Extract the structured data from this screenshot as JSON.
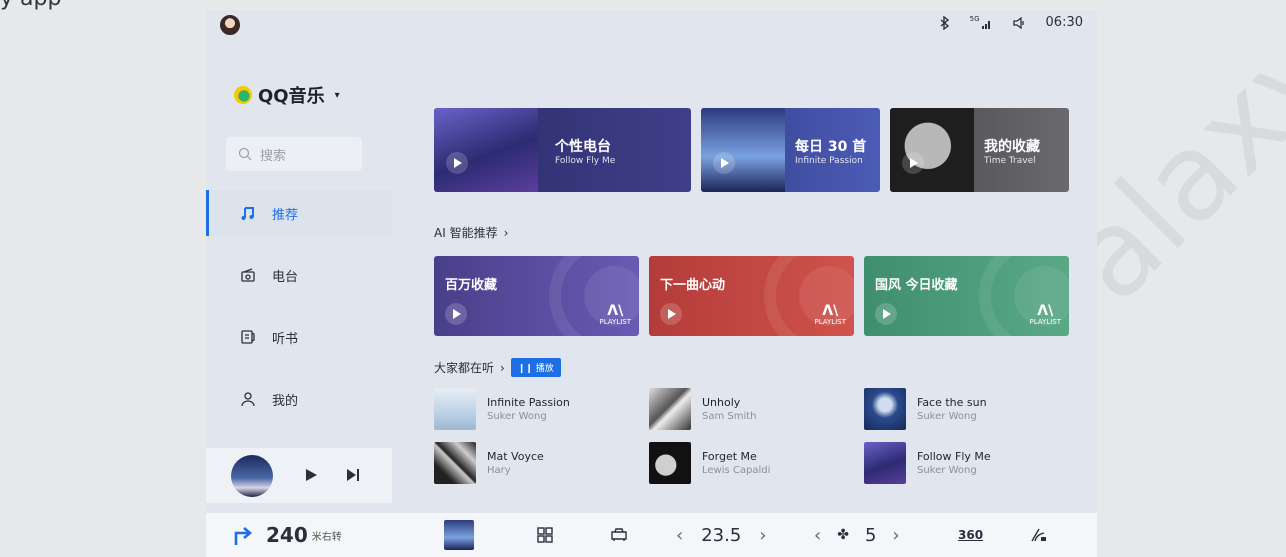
{
  "top_clip_text": "y app",
  "watermark": "alaxy",
  "status": {
    "time": "06:30",
    "signal_label": "5G"
  },
  "brand": {
    "name": "QQ音乐"
  },
  "search": {
    "placeholder": "搜索"
  },
  "nav": [
    {
      "label": "推荐",
      "icon": "music-note-icon",
      "active": true
    },
    {
      "label": "电台",
      "icon": "radio-icon",
      "active": false
    },
    {
      "label": "听书",
      "icon": "book-icon",
      "active": false
    },
    {
      "label": "我的",
      "icon": "user-icon",
      "active": false
    }
  ],
  "featured": [
    {
      "title": "个性电台",
      "subtitle": "Follow Fly Me"
    },
    {
      "title": "每日 30 首",
      "subtitle": "Infinite Passion"
    },
    {
      "title": "我的收藏",
      "subtitle": "Time Travel"
    }
  ],
  "ai_section": {
    "title": "AI 智能推荐"
  },
  "ai_cards": [
    {
      "title": "百万收藏",
      "badge": "PLAYLIST",
      "color": "#5a4f9e"
    },
    {
      "title": "下一曲心动",
      "badge": "PLAYLIST",
      "color": "#c2453f"
    },
    {
      "title": "国风 今日收藏",
      "badge": "PLAYLIST",
      "color": "#4f9e7f"
    }
  ],
  "popular": {
    "title": "大家都在听",
    "play_label": "播放"
  },
  "songs": [
    {
      "name": "Infinite Passion",
      "artist": "Suker Wong"
    },
    {
      "name": "Unholy",
      "artist": "Sam Smith"
    },
    {
      "name": "Face the sun",
      "artist": "Suker Wong"
    },
    {
      "name": "Mat Voyce",
      "artist": "Hary"
    },
    {
      "name": "Forget Me",
      "artist": "Lewis Capaldi"
    },
    {
      "name": "Follow Fly Me",
      "artist": "Suker Wong"
    }
  ],
  "bottom": {
    "distance": "240",
    "distance_unit": "米右转",
    "temperature": "23.5",
    "fan_speed": "5",
    "view_label": "360"
  },
  "colors": {
    "accent": "#1e6fe5",
    "background": "#e1e6ee"
  }
}
